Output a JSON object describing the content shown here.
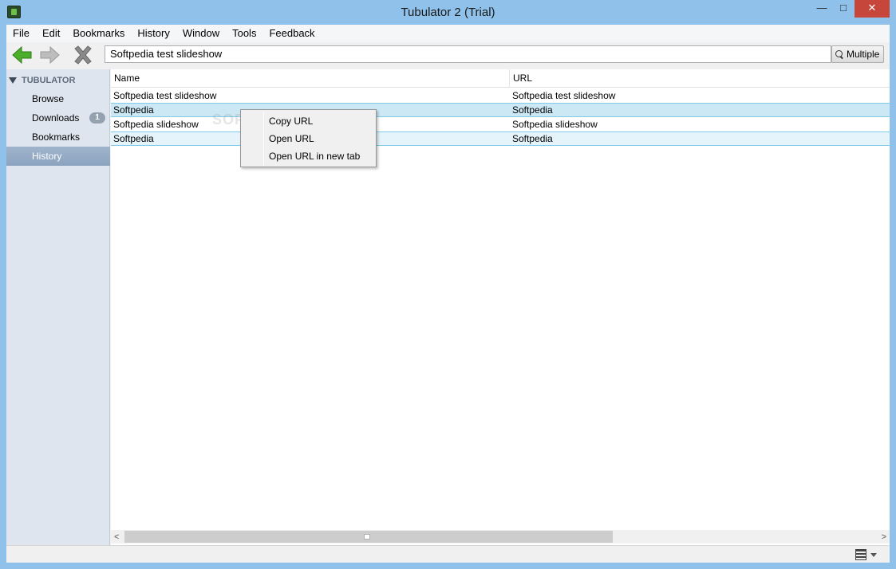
{
  "window": {
    "title": "Tubulator 2 (Trial)",
    "min": "—",
    "max": "□",
    "close": "✕"
  },
  "menu": [
    "File",
    "Edit",
    "Bookmarks",
    "History",
    "Window",
    "Tools",
    "Feedback"
  ],
  "toolbar": {
    "address_value": "Softpedia test slideshow",
    "multiple_label": "Multiple"
  },
  "sidebar": {
    "header": "TUBULATOR",
    "items": [
      {
        "label": "Browse"
      },
      {
        "label": "Downloads",
        "badge": "1"
      },
      {
        "label": "Bookmarks"
      },
      {
        "label": "History",
        "active": true
      }
    ]
  },
  "table": {
    "columns": [
      "Name",
      "URL"
    ],
    "rows": [
      {
        "name": "Softpedia test slideshow",
        "url": "Softpedia test slideshow"
      },
      {
        "name": "Softpedia",
        "url": "Softpedia"
      },
      {
        "name": "Softpedia slideshow",
        "url": "Softpedia slideshow"
      },
      {
        "name": "Softpedia",
        "url": "Softpedia"
      }
    ]
  },
  "context_menu": [
    "Copy URL",
    "Open URL",
    "Open URL in new tab"
  ],
  "watermark": "SOFTPEDIA",
  "colors": {
    "accent": "#8fc1ea",
    "selection": "#cde8f5",
    "close": "#c7463b",
    "sidebar": "#dee5ee",
    "back_arrow": "#4caf2a"
  }
}
